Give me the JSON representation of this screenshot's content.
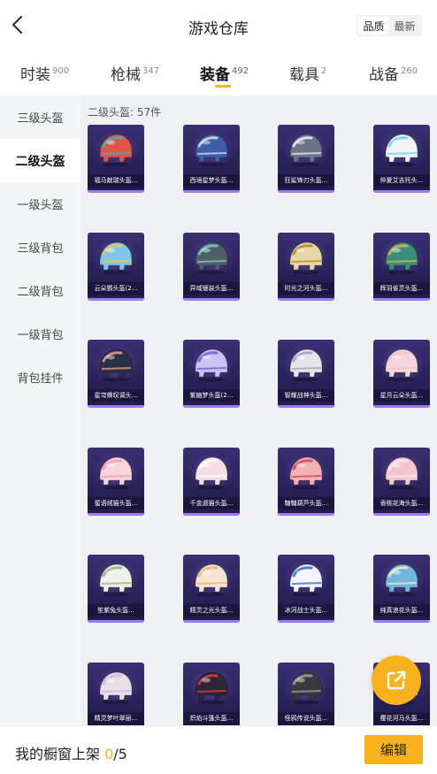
{
  "header": {
    "title": "游戏仓库",
    "sort_options": [
      "品质",
      "最新"
    ],
    "sort_active": 0
  },
  "tabs": [
    {
      "label": "时装",
      "count": "900"
    },
    {
      "label": "枪械",
      "count": "347"
    },
    {
      "label": "装备",
      "count": "492"
    },
    {
      "label": "载具",
      "count": "2"
    },
    {
      "label": "战备",
      "count": "260"
    }
  ],
  "tab_active": 2,
  "sidebar": {
    "items": [
      "三级头盔",
      "二级头盔",
      "一级头盔",
      "三级背包",
      "二级背包",
      "一级背包",
      "背包挂件"
    ],
    "active": 1
  },
  "content": {
    "count_label": "二级头盔: 57件"
  },
  "items": [
    {
      "name": "福马献瑞头盔...",
      "color": "#e0574a",
      "accent": "#3bb6a8"
    },
    {
      "name": "西境星梦头盔...",
      "color": "#3c5fa8",
      "accent": "#d8d0ff"
    },
    {
      "name": "狂鲨锋刃头盔...",
      "color": "#6b7388",
      "accent": "#e8e8ef"
    },
    {
      "name": "仲夏艾吉托头...",
      "color": "#f0f3f7",
      "accent": "#7ad0e6"
    },
    {
      "name": "云朵鹦头盔(2...",
      "color": "#7ec7ea",
      "accent": "#f5c24a"
    },
    {
      "name": "异域锯装头盔...",
      "color": "#4f6066",
      "accent": "#79c9c0"
    },
    {
      "name": "时光之河头盔...",
      "color": "#e6d7a6",
      "accent": "#b8892f"
    },
    {
      "name": "辉羽雀灵头盔...",
      "color": "#3a8f7c",
      "accent": "#d8b34a"
    },
    {
      "name": "星穹蜂叹调头...",
      "color": "#2a2f4a",
      "accent": "#e29a8a"
    },
    {
      "name": "紫幽梦头盔(2...",
      "color": "#c9c4f3",
      "accent": "#7c5cd6"
    },
    {
      "name": "智耀战神头盔...",
      "color": "#e5e5ea",
      "accent": "#a8a2b8"
    },
    {
      "name": "星月云朵头盔...",
      "color": "#f3d6dc",
      "accent": "#f3c0c8"
    },
    {
      "name": "蜜语绒猫头盔...",
      "color": "#f7d4da",
      "accent": "#f0a4b2"
    },
    {
      "name": "千金淑猫头盔...",
      "color": "#f7dde3",
      "accent": "#ffffff"
    },
    {
      "name": "糖糖葫芦头盔...",
      "color": "#f1b3b4",
      "accent": "#d4485a"
    },
    {
      "name": "香桃花海头盔...",
      "color": "#f3c6cf",
      "accent": "#fbe4e8"
    },
    {
      "name": "笙紫兔头盔...",
      "color": "#eef1e6",
      "accent": "#9fb28a"
    },
    {
      "name": "精灵之光头盔...",
      "color": "#f4e4d0",
      "accent": "#e9b47b"
    },
    {
      "name": "冰河战士头盔...",
      "color": "#f2f5fb",
      "accent": "#3c6fd0"
    },
    {
      "name": "纯真浪花头盔...",
      "color": "#6fb7de",
      "accent": "#f3e7a8"
    },
    {
      "name": "精灵梦叶翠丽...",
      "color": "#eadfe8",
      "accent": "#c9bfe0"
    },
    {
      "name": "炽焰斗篷头盔...",
      "color": "#2c2730",
      "accent": "#d93a4a"
    },
    {
      "name": "怪鸦传说头盔...",
      "color": "#3a3a3e",
      "accent": "#9a9aa3"
    },
    {
      "name": "樱花河马头盔...",
      "color": "#d9c6e8",
      "accent": "#ffffff"
    }
  ],
  "colors": {
    "accent": "#f5b31d",
    "card_bg": "#2a225a",
    "sidebar_bg": "#f4f5f7"
  },
  "bottom": {
    "shelf_label": "我的橱窗上架 ",
    "shelf_current": "0",
    "shelf_total": "/5",
    "edit_label": "编辑"
  },
  "fab": {
    "icon": "external-link-icon"
  }
}
